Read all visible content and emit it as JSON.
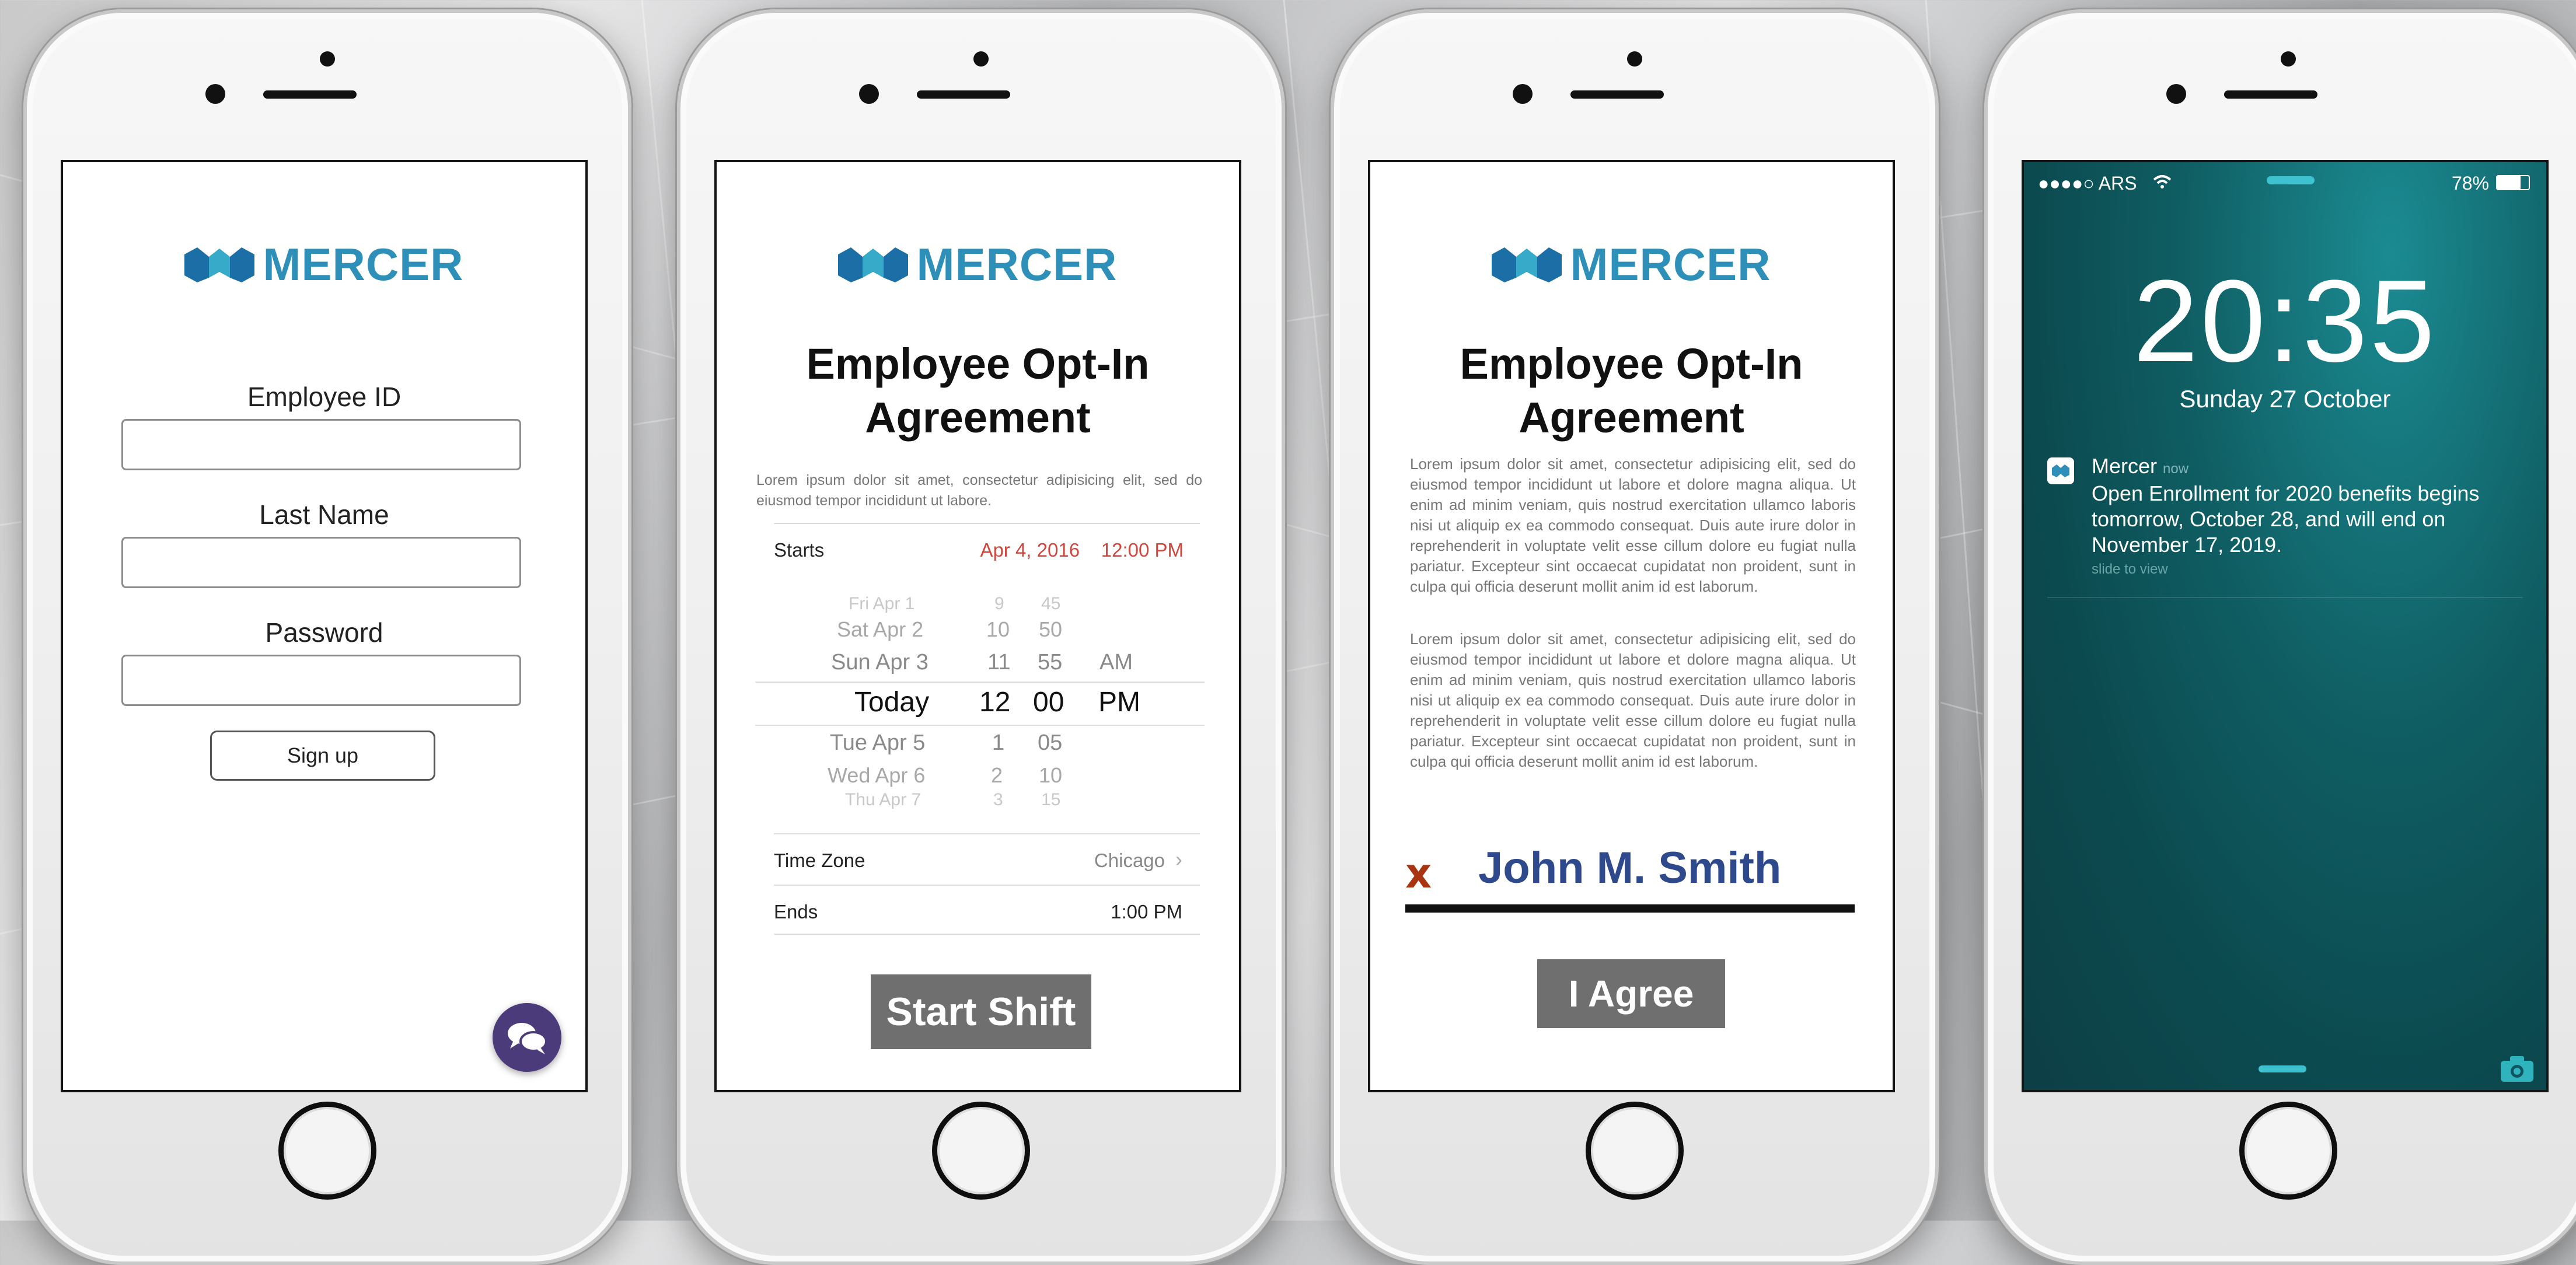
{
  "brand": {
    "name": "MERCER",
    "color": "#2e8fb8"
  },
  "login": {
    "fields": [
      {
        "label": "Employee ID",
        "value": ""
      },
      {
        "label": "Last Name",
        "value": ""
      },
      {
        "label": "Password",
        "value": ""
      }
    ],
    "signup_label": "Sign up",
    "chat_icon": "chat-bubbles-icon"
  },
  "shift": {
    "title_line1": "Employee Opt-In",
    "title_line2": "Agreement",
    "intro": "Lorem ipsum dolor sit amet, consectetur adipisicing elit, sed do eiusmod tempor incididunt ut labore.",
    "starts_label": "Starts",
    "starts_date": "Apr 4, 2016",
    "starts_time": "12:00 PM",
    "picker": {
      "rows": [
        {
          "day": "Fri Apr 1",
          "hour": "9",
          "min": "45",
          "ampm": ""
        },
        {
          "day": "Sat Apr 2",
          "hour": "10",
          "min": "50",
          "ampm": ""
        },
        {
          "day": "Sun Apr 3",
          "hour": "11",
          "min": "55",
          "ampm": "AM"
        },
        {
          "day": "Today",
          "hour": "12",
          "min": "00",
          "ampm": "PM"
        },
        {
          "day": "Tue Apr 5",
          "hour": "1",
          "min": "05",
          "ampm": ""
        },
        {
          "day": "Wed Apr 6",
          "hour": "2",
          "min": "10",
          "ampm": ""
        },
        {
          "day": "Thu Apr 7",
          "hour": "3",
          "min": "15",
          "ampm": ""
        }
      ]
    },
    "timezone_label": "Time Zone",
    "timezone_value": "Chicago",
    "ends_label": "Ends",
    "ends_value": "1:00 PM",
    "start_button": "Start Shift"
  },
  "agreement": {
    "title_line1": "Employee Opt-In",
    "title_line2": "Agreement",
    "paragraph1": "Lorem ipsum dolor sit amet, consectetur adipisicing elit, sed do eiusmod tempor incididunt ut labore et dolore magna aliqua. Ut enim ad minim veniam, quis nostrud exercitation ullamco laboris nisi ut aliquip ex ea commodo consequat. Duis aute irure dolor in reprehenderit in voluptate velit esse cillum dolore eu fugiat nulla pariatur. Excepteur sint occaecat cupidatat non proident, sunt in culpa qui officia deserunt mollit anim id est laborum.",
    "paragraph2": "Lorem ipsum dolor sit amet, consectetur adipisicing elit, sed do eiusmod tempor incididunt ut labore et dolore magna aliqua. Ut enim ad minim veniam, quis nostrud exercitation ullamco laboris nisi ut aliquip ex ea commodo consequat. Duis aute irure dolor in reprehenderit in voluptate velit esse cillum dolore eu fugiat nulla pariatur. Excepteur sint occaecat cupidatat non proident, sunt in culpa qui officia deserunt mollit anim id est laborum.",
    "signature_mark": "x",
    "signature_name": "John M. Smith",
    "agree_button": "I Agree"
  },
  "lockscreen": {
    "carrier": "●●●●○ ARS",
    "battery": "78%",
    "time": "20:35",
    "date": "Sunday 27 October",
    "notification": {
      "app": "Mercer",
      "when": "now",
      "body": "Open Enrollment for 2020 benefits begins tomorrow, October 28, and will end on November 17, 2019.",
      "hint": "slide to view"
    }
  }
}
